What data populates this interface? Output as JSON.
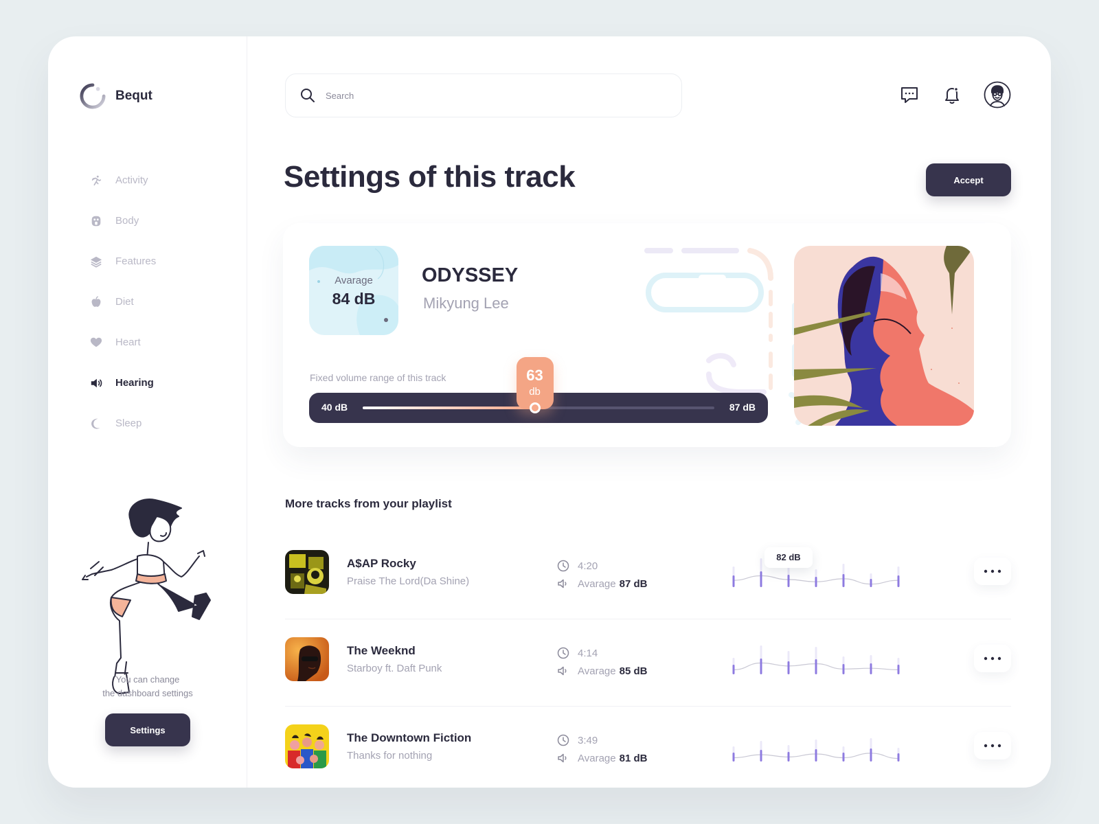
{
  "brand": {
    "name": "Bequt"
  },
  "search": {
    "placeholder": "Search"
  },
  "sidebar": {
    "items": [
      {
        "label": "Activity",
        "icon": "running-icon",
        "active": false
      },
      {
        "label": "Body",
        "icon": "body-icon",
        "active": false
      },
      {
        "label": "Features",
        "icon": "layers-icon",
        "active": false
      },
      {
        "label": "Diet",
        "icon": "apple-icon",
        "active": false
      },
      {
        "label": "Heart",
        "icon": "heart-icon",
        "active": false
      },
      {
        "label": "Hearing",
        "icon": "speaker-icon",
        "active": true
      },
      {
        "label": "Sleep",
        "icon": "moon-icon",
        "active": false
      }
    ],
    "note_line1": "You can change",
    "note_line2": "the dashboard settings",
    "settings_label": "Settings"
  },
  "header": {
    "icons": [
      "chat-icon",
      "bell-icon",
      "user-avatar"
    ]
  },
  "page": {
    "title": "Settings of this track",
    "accept_label": "Accept"
  },
  "track": {
    "average_label": "Avarage",
    "average_value": "84 dB",
    "name": "ODYSSEY",
    "artist": "Mikyung Lee",
    "range_label": "Fixed volume range of this track",
    "slider": {
      "min_label": "40 dB",
      "max_label": "87 dB",
      "min": 40,
      "max": 87,
      "value": 63,
      "bubble_value": "63",
      "bubble_unit": "db"
    }
  },
  "playlist": {
    "title": "More tracks from your playlist",
    "average_label": "Avarage",
    "tracks": [
      {
        "artist": "A$AP Rocky",
        "song": "Praise The Lord(Da Shine)",
        "duration": "4:20",
        "average": "87 dB",
        "tooltip": "82 dB",
        "wave": [
          0.45,
          0.75,
          0.5,
          0.35,
          0.55,
          0.2,
          0.45
        ]
      },
      {
        "artist": "The Weeknd",
        "song": "Starboy ft. Daft Punk",
        "duration": "4:14",
        "average": "85 dB",
        "tooltip": "",
        "wave": [
          0.3,
          0.75,
          0.55,
          0.7,
          0.35,
          0.4,
          0.3
        ]
      },
      {
        "artist": "The Downtown Fiction",
        "song": "Thanks for nothing",
        "duration": "3:49",
        "average": "81 dB",
        "tooltip": "",
        "wave": [
          0.25,
          0.45,
          0.3,
          0.5,
          0.25,
          0.55,
          0.2
        ]
      }
    ]
  },
  "colors": {
    "dark": "#37344d",
    "accent_peach": "#f4a585",
    "accent_purple": "#8e7be0",
    "muted": "#b9b8c6"
  }
}
